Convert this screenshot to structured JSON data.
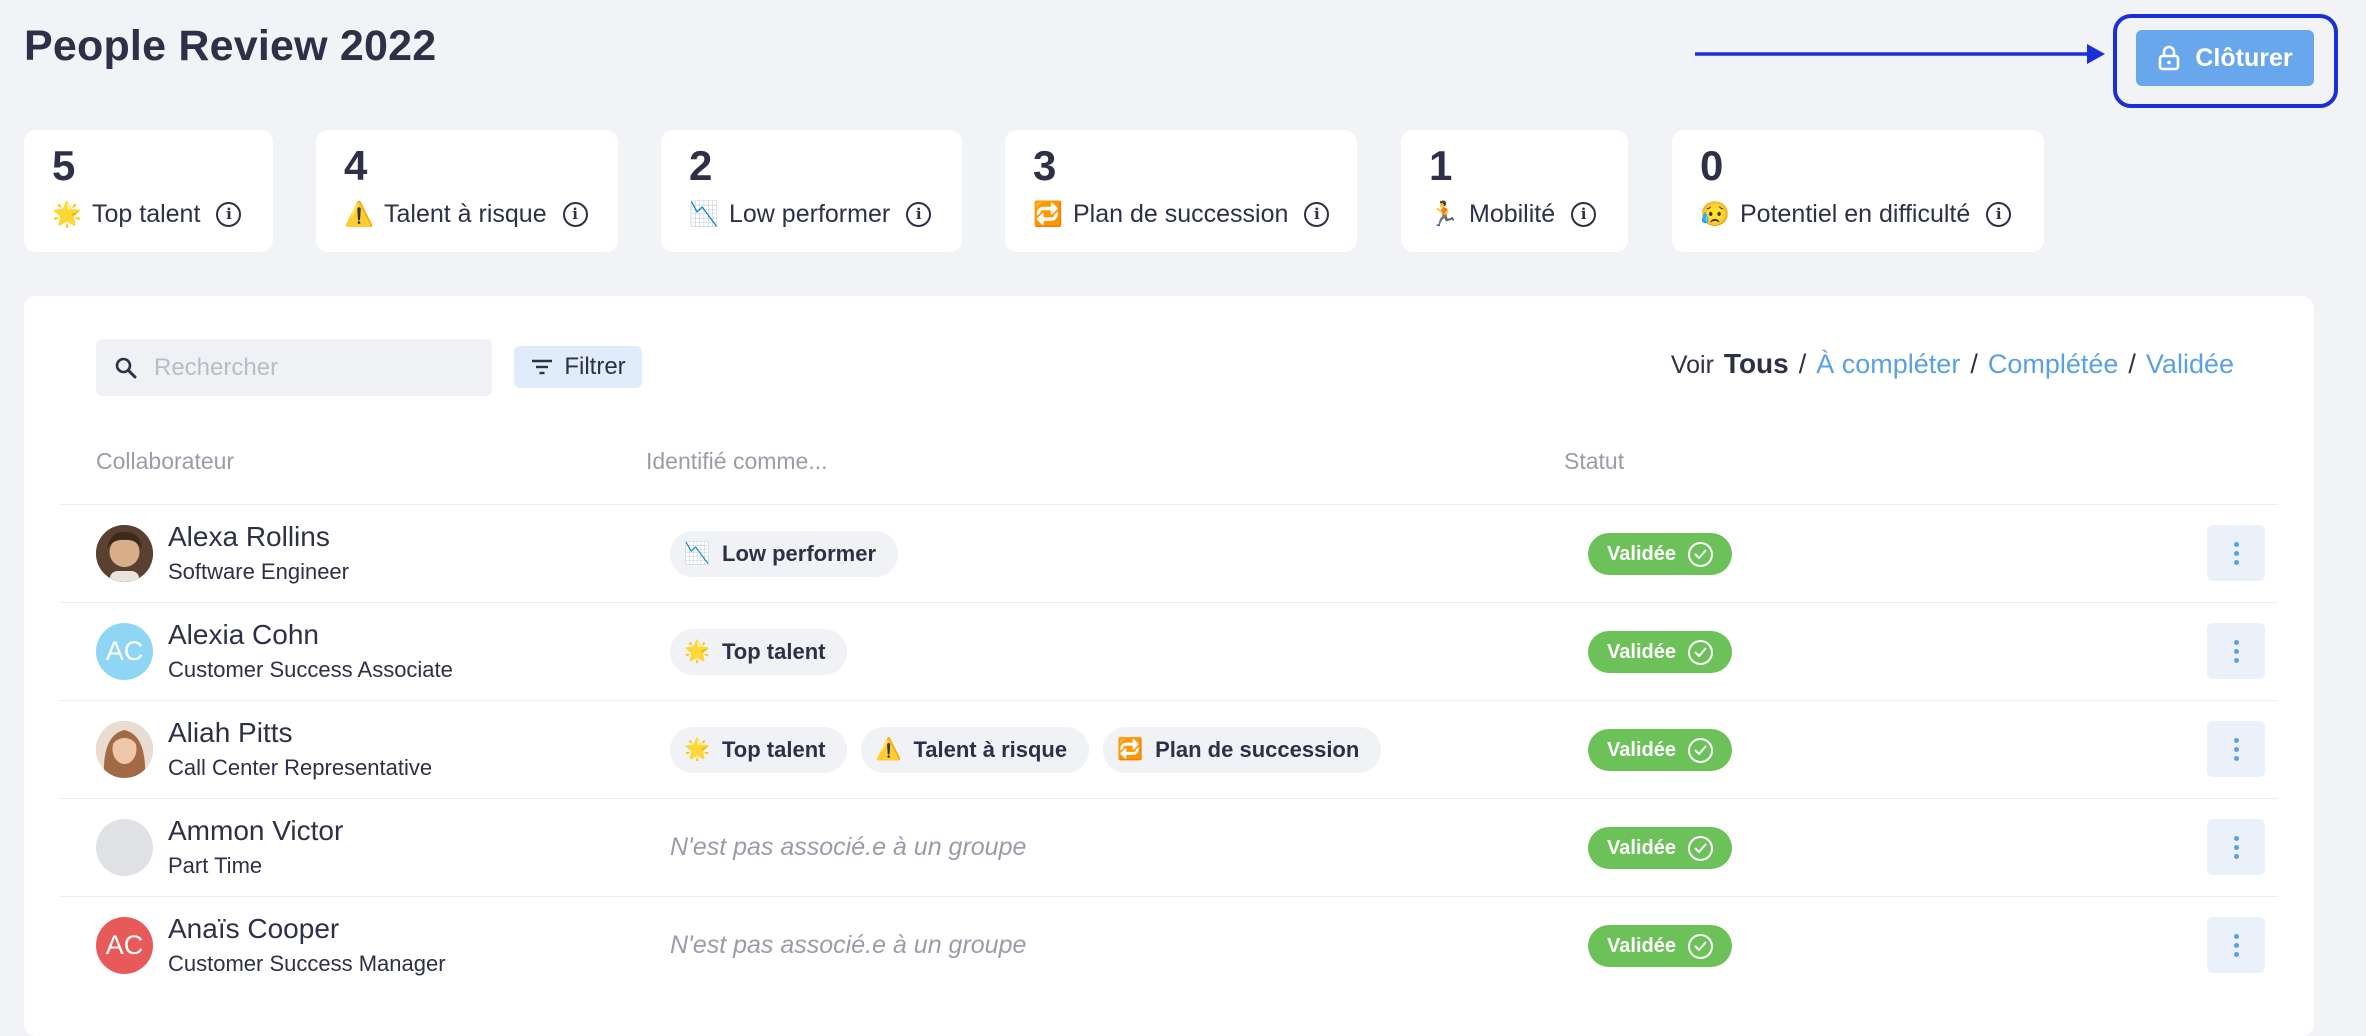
{
  "page": {
    "title": "People Review 2022"
  },
  "header": {
    "close_button": "Clôturer",
    "lock_icon": "lock-icon"
  },
  "kpis": [
    {
      "count": "5",
      "emoji": "🌟",
      "label": "Top talent"
    },
    {
      "count": "4",
      "emoji": "⚠️",
      "label": "Talent à risque"
    },
    {
      "count": "2",
      "emoji": "📉",
      "label": "Low performer"
    },
    {
      "count": "3",
      "emoji": "🔁",
      "label": "Plan de succession"
    },
    {
      "count": "1",
      "emoji": "🏃",
      "label": "Mobilité"
    },
    {
      "count": "0",
      "emoji": "😥",
      "label": "Potentiel en difficulté"
    }
  ],
  "toolbar": {
    "search_placeholder": "Rechercher",
    "filter_label": "Filtrer",
    "view_label": "Voir",
    "view_options": [
      "Tous",
      "À compléter",
      "Complétée",
      "Validée"
    ]
  },
  "table": {
    "headers": {
      "collaborator": "Collaborateur",
      "identified": "Identifié comme...",
      "status": "Statut"
    },
    "rows": [
      {
        "name": "Alexa Rollins",
        "role": "Software Engineer",
        "avatar_initials": "",
        "avatar_color": "#7a5a3a",
        "tags": [
          {
            "emoji": "📉",
            "label": "Low performer"
          }
        ],
        "empty_text": "",
        "status": "Validée"
      },
      {
        "name": "Alexia Cohn",
        "role": "Customer Success Associate",
        "avatar_initials": "AC",
        "avatar_color": "#8fd6f5",
        "tags": [
          {
            "emoji": "🌟",
            "label": "Top talent"
          }
        ],
        "empty_text": "",
        "status": "Validée"
      },
      {
        "name": "Aliah Pitts",
        "role": "Call Center Representative",
        "avatar_initials": "",
        "avatar_color": "#c99a7a",
        "tags": [
          {
            "emoji": "🌟",
            "label": "Top talent"
          },
          {
            "emoji": "⚠️",
            "label": "Talent à risque"
          },
          {
            "emoji": "🔁",
            "label": "Plan de succession"
          }
        ],
        "empty_text": "",
        "status": "Validée"
      },
      {
        "name": "Ammon Victor",
        "role": "Part Time",
        "avatar_initials": "",
        "avatar_color": "#dfe1e4",
        "tags": [],
        "empty_text": "N'est pas associé.e à un groupe",
        "status": "Validée"
      },
      {
        "name": "Anaïs Cooper",
        "role": "Customer Success Manager",
        "avatar_initials": "AC",
        "avatar_color": "#e85a5a",
        "tags": [],
        "empty_text": "N'est pas associé.e à un groupe",
        "status": "Validée"
      }
    ]
  },
  "colors": {
    "accent": "#5aa0e6",
    "button": "#69a7ec",
    "status_valid": "#6cc158",
    "annotation": "#1a2fd6"
  }
}
